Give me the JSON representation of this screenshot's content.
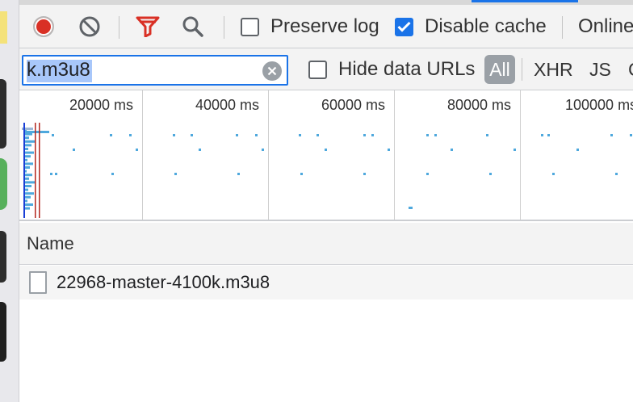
{
  "toolbar": {
    "record_state": "recording",
    "preserve_log": {
      "label": "Preserve log",
      "checked": false
    },
    "disable_cache": {
      "label": "Disable cache",
      "checked": true
    },
    "throttling": "Online"
  },
  "filterbar": {
    "filter_value": "k.m3u8",
    "hide_data_urls": {
      "label": "Hide data URLs",
      "checked": false
    },
    "types": [
      "All",
      "XHR",
      "JS",
      "C"
    ],
    "selected_type": "All"
  },
  "overview": {
    "ticks": [
      "20000 ms",
      "40000 ms",
      "60000 ms",
      "80000 ms",
      "100000 ms"
    ]
  },
  "table": {
    "columns": [
      "Name"
    ],
    "rows": [
      {
        "name": "22968-master-4100k.m3u8"
      }
    ]
  },
  "colors": {
    "record": "#d93025",
    "accent": "#1a73e8",
    "timeline_bar": "#4ea8dd",
    "dom_content_loaded": "#1a3fd6",
    "load": "#b3261e"
  },
  "icons": [
    "record-icon",
    "clear-icon",
    "filter-icon",
    "search-icon",
    "checkbox-icon",
    "clear-input-icon",
    "document-file-icon"
  ]
}
